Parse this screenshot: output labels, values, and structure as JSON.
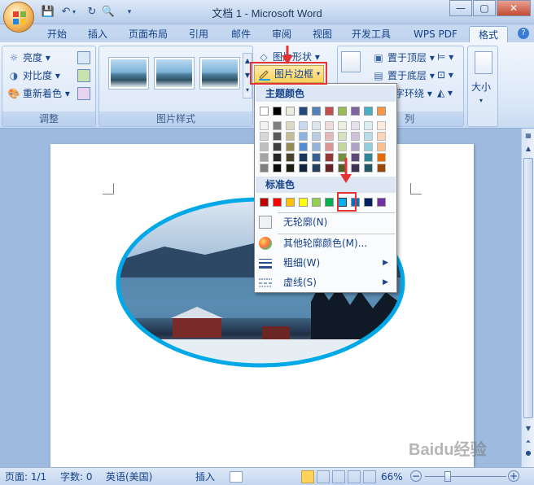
{
  "titlebar": {
    "title": "文档 1 - Microsoft Word",
    "qat": [
      "save-icon",
      "undo-icon",
      "redo-icon",
      "print-preview-icon",
      "customize-icon"
    ],
    "window_buttons": [
      "—",
      "▢",
      "✕"
    ]
  },
  "tabs": [
    "开始",
    "插入",
    "页面布局",
    "引用",
    "邮件",
    "审阅",
    "视图",
    "开发工具",
    "WPS PDF",
    "格式"
  ],
  "active_tab": "格式",
  "ribbon": {
    "adjust": {
      "items": [
        "亮度",
        "对比度",
        "重新着色"
      ],
      "label": "调整"
    },
    "styles": {
      "label": "图片样式",
      "buttons": [
        "图片形状",
        "图片边框"
      ]
    },
    "arrange": {
      "items": [
        "置于顶层",
        "置于底层",
        "字环绕"
      ],
      "label_partial": "列"
    },
    "size": {
      "label": "大小"
    }
  },
  "dropdown": {
    "theme_header": "主题颜色",
    "standard_header": "标准色",
    "theme_colors_top": [
      "#ffffff",
      "#000000",
      "#eeece1",
      "#1f497d",
      "#4f81bd",
      "#c0504d",
      "#9bbb59",
      "#8064a2",
      "#4bacc6",
      "#f79646"
    ],
    "theme_shades": [
      [
        "#f2f2f2",
        "#d8d8d8",
        "#bfbfbf",
        "#a5a5a5",
        "#7f7f7f"
      ],
      [
        "#7f7f7f",
        "#595959",
        "#3f3f3f",
        "#262626",
        "#0c0c0c"
      ],
      [
        "#ddd9c3",
        "#c4bd97",
        "#938953",
        "#494429",
        "#1d1b10"
      ],
      [
        "#c6d9f0",
        "#8db3e2",
        "#548dd4",
        "#17365d",
        "#0f243e"
      ],
      [
        "#dbe5f1",
        "#b8cce4",
        "#95b3d7",
        "#366092",
        "#244061"
      ],
      [
        "#f2dcdb",
        "#e5b9b7",
        "#d99694",
        "#953734",
        "#632423"
      ],
      [
        "#ebf1dd",
        "#d7e3bc",
        "#c3d69b",
        "#76923c",
        "#4f6128"
      ],
      [
        "#e5e0ec",
        "#ccc1d9",
        "#b2a2c7",
        "#5f497a",
        "#3f3151"
      ],
      [
        "#dbeef3",
        "#b7dde8",
        "#92cddc",
        "#31859b",
        "#205867"
      ],
      [
        "#fdeada",
        "#fbd5b5",
        "#fac08f",
        "#e36c09",
        "#974806"
      ]
    ],
    "standard_colors": [
      "#c00000",
      "#ff0000",
      "#ffc000",
      "#ffff00",
      "#92d050",
      "#00b050",
      "#00b0f0",
      "#0070c0",
      "#002060",
      "#7030a0"
    ],
    "selected_standard": 6,
    "no_outline": "无轮廓(N)",
    "more_colors": "其他轮廓颜色(M)...",
    "weight": "粗细(W)",
    "dashes": "虚线(S)"
  },
  "statusbar": {
    "page": "页面: 1/1",
    "words": "字数: 0",
    "language": "英语(美国)",
    "insert_mode": "插入",
    "zoom": "66%"
  },
  "watermark": "Baidu经验",
  "colors": {
    "accent": "#15428b",
    "border_accent": "#00a8e8",
    "highlight": "#e53333"
  }
}
